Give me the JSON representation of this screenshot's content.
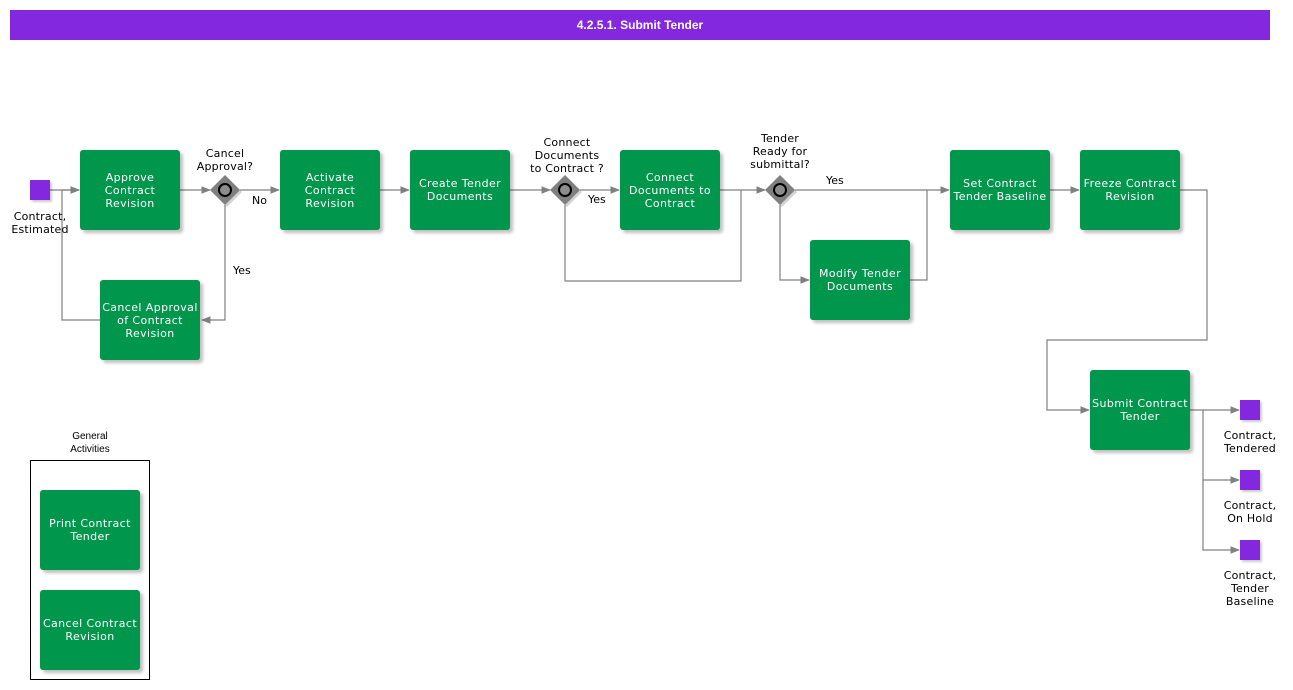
{
  "title": "4.2.5.1. Submit Tender",
  "colors": {
    "header": "#8428e0",
    "task": "#00964b",
    "state": "#8428e0",
    "gateway": "#808080",
    "edge": "#808080"
  },
  "states": {
    "start": "Contract,\nEstimated",
    "tendered": "Contract,\nTendered",
    "on_hold": "Contract,\nOn Hold",
    "tender_baseline": "Contract,\nTender\nBaseline"
  },
  "tasks": {
    "approve": "Approve\nContract\nRevision",
    "cancel_approval": "Cancel Approval\nof Contract\nRevision",
    "activate": "Activate\nContract\nRevision",
    "create_docs": "Create Tender\nDocuments",
    "connect_docs": "Connect\nDocuments to\nContract",
    "modify_docs": "Modify Tender\nDocuments",
    "set_baseline": "Set Contract\nTender Baseline",
    "freeze": "Freeze Contract\nRevision",
    "submit": "Submit Contract\nTender"
  },
  "gateways": {
    "cancel_approval": "Cancel\nApproval?",
    "connect_docs": "Connect\nDocuments\nto Contract ?",
    "tender_ready": "Tender\nReady for\nsubmittal?"
  },
  "edge_labels": {
    "no": "No",
    "yes1": "Yes",
    "yes2": "Yes",
    "yes3": "Yes"
  },
  "general": {
    "title": "General\nActivities",
    "items": [
      "Print Contract\nTender",
      "Cancel Contract\nRevision"
    ]
  }
}
